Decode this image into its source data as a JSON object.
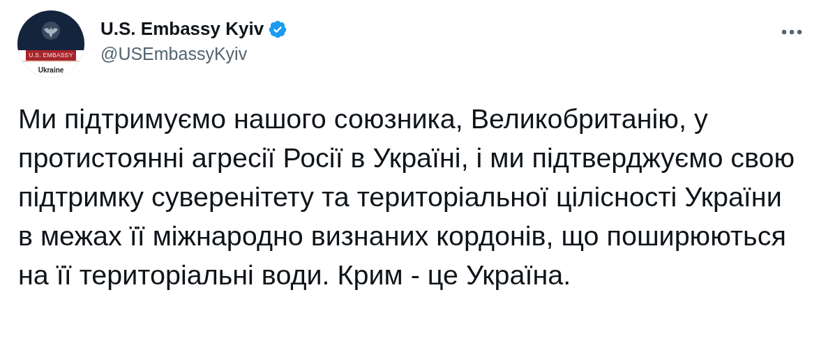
{
  "avatar": {
    "band_text": "U.S. EMBASSY",
    "caption": "Ukraine"
  },
  "author": {
    "name": "U.S. Embassy Kyiv",
    "verified": true,
    "handle": "@USEmbassyKyiv"
  },
  "text": "Ми підтримуємо нашого союзника, Великобританію, у протистоянні агресії Росії в Україні, і ми підтверджуємо свою підтримку суверенітету та територіальної цілісності України в межах її міжнародно визнаних кордонів, що поширюються на її територіальні води. Крим - це Україна."
}
